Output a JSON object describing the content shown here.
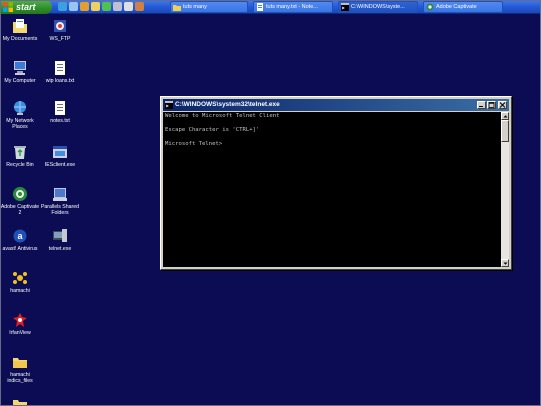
{
  "taskbar": {
    "start_label": "start",
    "tasks": [
      {
        "label": "tuts many",
        "icon": "folder-icon"
      },
      {
        "label": "tuts many.txt - Note...",
        "icon": "notepad-icon"
      },
      {
        "label": "C:\\WINDOWS\\syste...",
        "icon": "cmd-icon"
      },
      {
        "label": "Adobe Captivate",
        "icon": "captivate-icon"
      }
    ]
  },
  "desktop": {
    "icons": [
      {
        "label": "My Documents",
        "icon": "my-documents-icon"
      },
      {
        "label": "WS_FTP",
        "icon": "ws-ftp-icon"
      },
      {
        "label": "My Computer",
        "icon": "my-computer-icon"
      },
      {
        "label": "wip loans.txt",
        "icon": "text-file-icon"
      },
      {
        "label": "My Network Places",
        "icon": "network-places-icon"
      },
      {
        "label": "notes.txt",
        "icon": "text-file-icon"
      },
      {
        "label": "Recycle Bin",
        "icon": "recycle-bin-icon"
      },
      {
        "label": "IESclient.exe",
        "icon": "exe-icon"
      },
      {
        "label": "Adobe Captivate 2",
        "icon": "captivate-icon"
      },
      {
        "label": "Parallels Shared Folders",
        "icon": "shared-folders-icon"
      },
      {
        "label": "avast! Antivirus",
        "icon": "antivirus-icon"
      },
      {
        "label": "telnet.exe",
        "icon": "telnet-exe-icon"
      },
      {
        "label": "hamachi",
        "icon": "hamachi-icon"
      },
      {
        "label": "IrfanView",
        "icon": "irfanview-icon"
      },
      {
        "label": "hamachi indics_files",
        "icon": "folder-icon"
      }
    ]
  },
  "telnet_window": {
    "title": "C:\\WINDOWS\\system32\\telnet.exe",
    "lines": [
      "Welcome to Microsoft Telnet Client",
      "",
      "Escape Character is 'CTRL+]'",
      "",
      "Microsoft Telnet>"
    ]
  },
  "colors": {
    "desktop": "#0b0c54",
    "taskbar": "#2458d6",
    "start": "#2f8e2a",
    "title_bar": "#0a246a",
    "console_bg": "#000000",
    "console_text": "#c0c0c0"
  }
}
